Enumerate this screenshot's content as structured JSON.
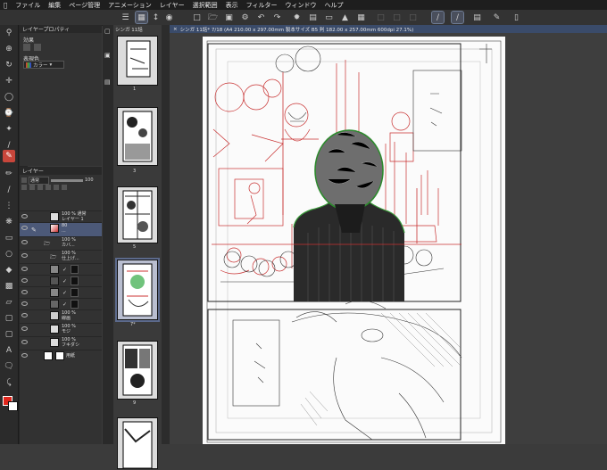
{
  "menubar": {
    "items": [
      "ファイル",
      "編集",
      "ページ管理",
      "アニメーション",
      "レイヤー",
      "選択範囲",
      "表示",
      "フィルター",
      "ウィンドウ",
      "ヘルプ"
    ]
  },
  "props_panel": {
    "title": "レイヤープロパティ",
    "effect_label": "効果",
    "color_label": "表現色",
    "color_value": "カラー"
  },
  "layer_panel": {
    "title": "レイヤー",
    "blend_mode": "通常",
    "opacity": "100",
    "layers": [
      {
        "name": "100 % 通常\nレイヤー 1"
      },
      {
        "name": "80\n..."
      },
      {
        "name": "100 %\nカバ..."
      },
      {
        "name": "100 %\n仕上げ..."
      },
      {
        "name": ""
      },
      {
        "name": ""
      },
      {
        "name": ""
      },
      {
        "name": ""
      },
      {
        "name": "100 %\n線画"
      },
      {
        "name": "100 %\nモジ"
      },
      {
        "name": "100 %\nフキダシ"
      },
      {
        "name": "用紙"
      }
    ]
  },
  "page_manager": {
    "title": "シンガ 11話",
    "pages": [
      "1",
      "",
      "3",
      "",
      "5",
      "",
      "7*",
      "",
      "9",
      ""
    ]
  },
  "canvas": {
    "tab_title": "シンガ 11話* 7/18 (A4 210.00 x 297.00mm 製本サイズ B5 判 182.00 x 257.00mm 600dpi 27.1%)"
  },
  "colors": {
    "main_color": "#e0261c",
    "sub_color": "#ffffff",
    "accent": "#4c5978"
  }
}
